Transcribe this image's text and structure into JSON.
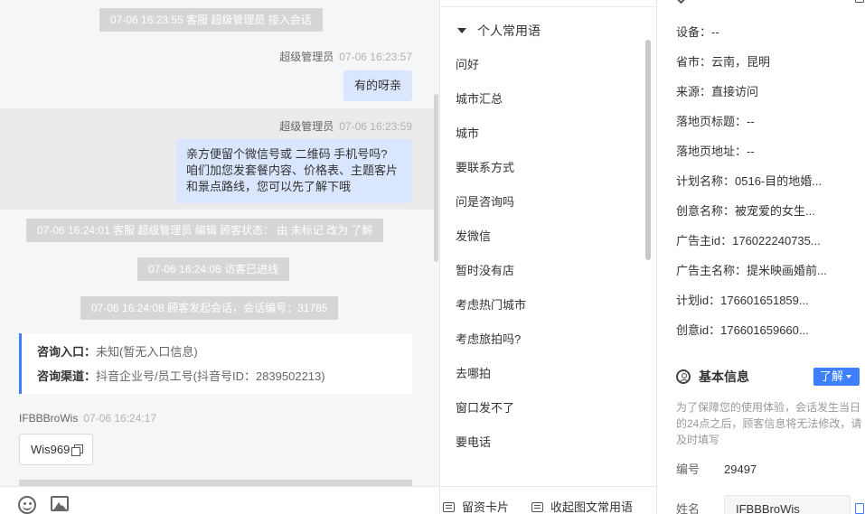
{
  "chat": {
    "sys_join": "07-06 16:23:55 客服 超级管理员 接入会话",
    "msg1": {
      "sender": "超级管理员",
      "time": "07-06 16:23:57",
      "text": "有的呀亲"
    },
    "msg2": {
      "sender": "超级管理员",
      "time": "07-06 16:23:59",
      "lines": [
        "亲方便留个微信号或 二维码 手机号吗?",
        "咱们加您发套餐内容、价格表、主题客片",
        "和景点路线，您可以先了解下哦"
      ]
    },
    "sys_edit": "07-06 16:24:01 客服 超级管理员 编辑 顾客状态： 由 未标记 改为 了解",
    "sys_offline": "07-06 16:24:08 访客已进线",
    "sys_session": "07-06 16:24:08 顾客发起会话，会话编号：31785",
    "entry_card": {
      "entry_label": "咨询入口：",
      "entry_value": "未知(暂无入口信息)",
      "channel_label": "咨询渠道：",
      "channel_value": "抖音企业号/员工号(抖音号ID：2839502213)"
    },
    "visitor_msg": {
      "sender": "IFBBBroWis",
      "time": "07-06 16:24:17",
      "text": "Wis969"
    }
  },
  "phrases": {
    "group_label": "个人常用语",
    "items": [
      "问好",
      "城市汇总",
      "城市",
      "要联系方式",
      "问是咨询吗",
      "发微信",
      "暂时没有店",
      "考虑热门城市",
      "考虑旅拍吗?",
      "去哪拍",
      "窗口发不了",
      "要电话"
    ],
    "footer_card": "留资卡片",
    "footer_collapse": "收起图文常用语"
  },
  "info": {
    "source_rows": [
      "设备：--",
      "省市：云南，昆明",
      "来源：直接访问",
      "落地页标题：--",
      "落地页地址：--",
      "计划名称：0516-目的地婚...",
      "创意名称：被宠爱的女生...",
      "广告主id：176022240735...",
      "广告主名称：提米映画婚前...",
      "计划id：176601651859...",
      "创意id：176601659660..."
    ],
    "basic_title": "基本信息",
    "learn_button": "了解",
    "notice": "为了保障您的使用体验，会话发生当日的24点之后，顾客信息将无法修改，请及时填写",
    "id_label": "编号",
    "id_value": "29497",
    "name_label": "姓名",
    "name_value": "IFBBBroWis"
  },
  "colors": {
    "accent": "#3d7fff",
    "agent_bubble": "#d9e6fd",
    "system_pill": "#d6d6d6",
    "chat_bg": "#f5f6f8"
  }
}
